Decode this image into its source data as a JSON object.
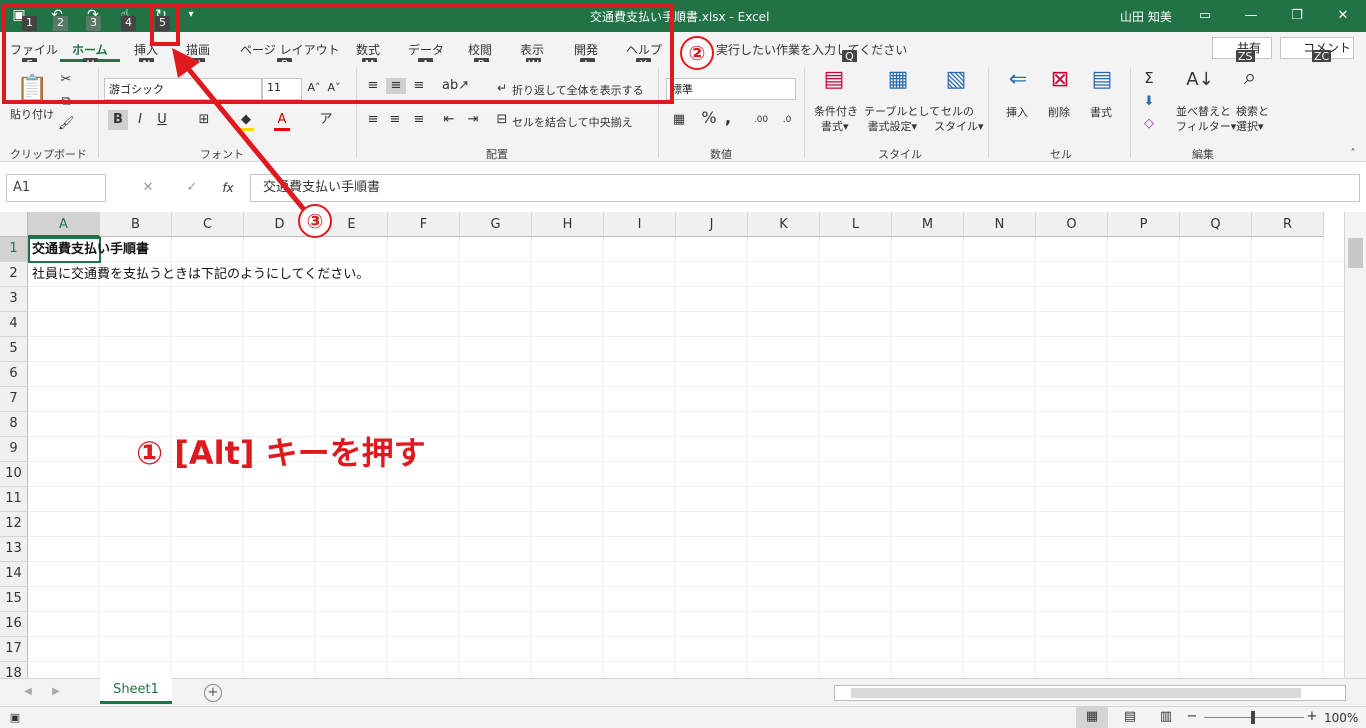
{
  "title": {
    "doc": "交通費支払い手順書.xlsx",
    "sep": "-",
    "app": "Excel",
    "user": "山田 知美"
  },
  "qat_keytips": [
    "1",
    "2",
    "3",
    "4",
    "5"
  ],
  "tabs": [
    {
      "label": "ファイル",
      "key": "F"
    },
    {
      "label": "ホーム",
      "key": "H"
    },
    {
      "label": "挿入",
      "key": "N"
    },
    {
      "label": "描画",
      "key": "JI"
    },
    {
      "label": "ページ レイアウト",
      "key": "P"
    },
    {
      "label": "数式",
      "key": "M"
    },
    {
      "label": "データ",
      "key": "A"
    },
    {
      "label": "校閲",
      "key": "R"
    },
    {
      "label": "表示",
      "key": "W"
    },
    {
      "label": "開発",
      "key": "L"
    },
    {
      "label": "ヘルプ",
      "key": "Y"
    }
  ],
  "tellme": {
    "text": "実行したい作業を入力してください",
    "key": "Q"
  },
  "share": {
    "label": "共有",
    "key": "ZS"
  },
  "comment": {
    "label": "コメント",
    "key": "ZC"
  },
  "ribbon": {
    "paste": "貼り付け",
    "clipboard": "クリップボード",
    "font_name": "游ゴシック",
    "font_size": "11",
    "font_group": "フォント",
    "wrap_text": "折り返して全体を表示する",
    "merge_center": "セルを結合して中央揃え",
    "align_group": "配置",
    "number_format": "標準",
    "number_group": "数値",
    "cond_format": [
      "条件付き",
      "書式"
    ],
    "table_format": [
      "テーブルとして",
      "書式設定"
    ],
    "cell_style": [
      "セルの",
      "スタイル"
    ],
    "style_group": "スタイル",
    "insert": "挿入",
    "delete": "削除",
    "format": "書式",
    "cells_group": "セル",
    "sort_filter": [
      "並べ替えと",
      "フィルター"
    ],
    "find_select": [
      "検索と",
      "選択"
    ],
    "edit_group": "編集"
  },
  "namebox": "A1",
  "formula": "交通費支払い手順書",
  "columns": [
    "A",
    "B",
    "C",
    "D",
    "E",
    "F",
    "G",
    "H",
    "I",
    "J",
    "K",
    "L",
    "M",
    "N",
    "O",
    "P",
    "Q",
    "R"
  ],
  "rows": [
    "1",
    "2",
    "3",
    "4",
    "5",
    "6",
    "7",
    "8",
    "9",
    "10",
    "11",
    "12",
    "13",
    "14",
    "15",
    "16",
    "17",
    "18"
  ],
  "cells": {
    "a1": "交通費支払い手順書",
    "a2": "社員に交通費を支払うときは下記のようにしてください。"
  },
  "sheet_tab": "Sheet1",
  "zoom": "100%",
  "annotations": {
    "c1": "①",
    "c1_text": "[Alt] キーを押す",
    "c2": "②",
    "c3": "③"
  },
  "accent": "#217346",
  "annotation_color": "#e0191e"
}
